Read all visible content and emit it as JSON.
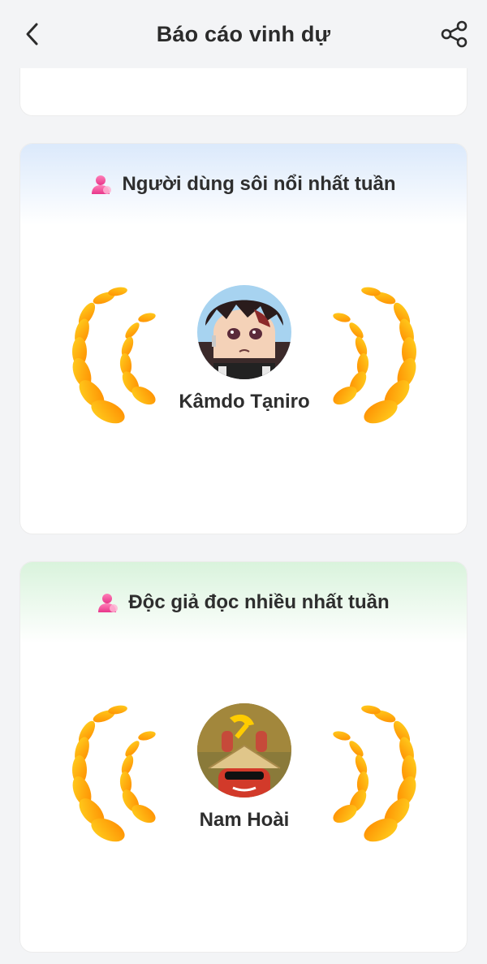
{
  "header": {
    "title": "Báo cáo vinh dự",
    "back_icon": "chevron-left-icon",
    "share_icon": "share-icon"
  },
  "sections": [
    {
      "title": "Người dùng sôi nổi nhất tuần",
      "icon": "user-icon",
      "winner_name": "Kâmdo Tạniro",
      "accent": "#dbe9fb"
    },
    {
      "title": "Độc giả đọc nhiều nhất tuần",
      "icon": "user-icon",
      "winner_name": "Nam Hoài",
      "accent": "#d9f3dc"
    }
  ],
  "colors": {
    "laurel_light": "#ffd21f",
    "laurel_dark": "#ff8a00",
    "user_icon": "#f0509a"
  }
}
